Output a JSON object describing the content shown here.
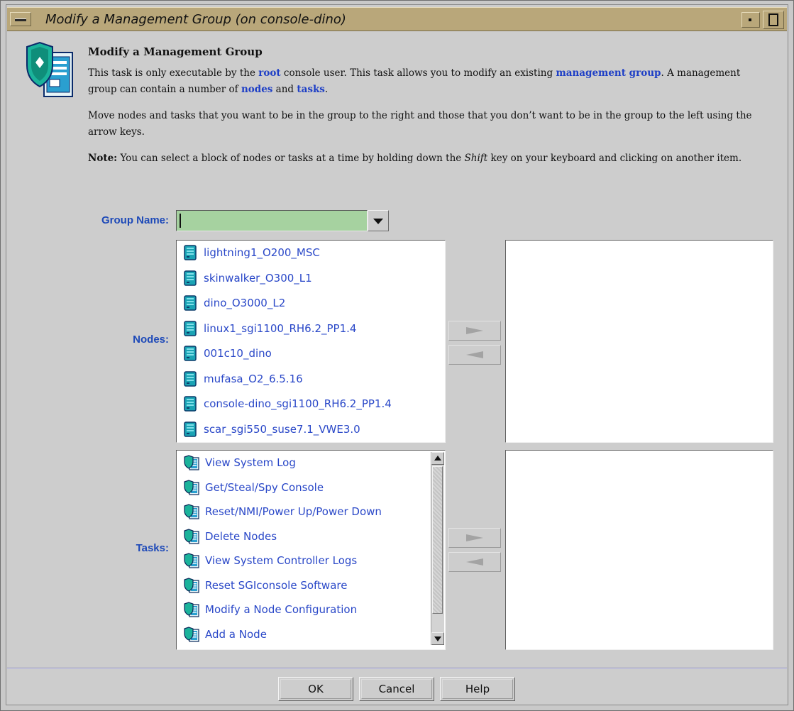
{
  "window": {
    "title": "Modify a Management Group (on console-dino)"
  },
  "header": {
    "heading": "Modify a Management Group",
    "p1": {
      "t1": "This task is only executable by the ",
      "l1": "root",
      "t2": " console user. This task allows you to modify an existing ",
      "l2": "management group",
      "t3": ". A management group can contain a number of ",
      "l3": "nodes",
      "t4": " and ",
      "l4": "tasks",
      "t5": "."
    },
    "p2": "Move nodes and tasks that you want to be in the group to the right and those that you don’t want to be in the group to the left using the arrow keys.",
    "p3": {
      "note_label": "Note:",
      "t1": " You can select a block of nodes or tasks at a time by holding down the ",
      "em": "Shift",
      "t2": " key on your keyboard and clicking on another item."
    }
  },
  "form": {
    "group_name_label": "Group Name:",
    "group_name_value": "",
    "nodes_label": "Nodes:",
    "tasks_label": "Tasks:"
  },
  "nodes": [
    "lightning1_O200_MSC",
    "skinwalker_O300_L1",
    "dino_O3000_L2",
    "linux1_sgi1100_RH6.2_PP1.4",
    "001c10_dino",
    "mufasa_O2_6.5.16",
    "console-dino_sgi1100_RH6.2_PP1.4",
    "scar_sgi550_suse7.1_VWE3.0"
  ],
  "tasks": [
    "View System Log",
    "Get/Steal/Spy Console",
    "Reset/NMI/Power Up/Power Down",
    "Delete Nodes",
    "View System Controller Logs",
    "Reset SGIconsole Software",
    "Modify a Node Configuration",
    "Add a Node"
  ],
  "buttons": {
    "ok": "OK",
    "cancel": "Cancel",
    "help": "Help"
  },
  "colors": {
    "title_bar": "#b9a77a",
    "link": "#1e3fc6",
    "label": "#1d49b8",
    "combo_field": "#a6d2a0"
  },
  "icons": {
    "window_menu": "window-menu-icon",
    "minimize": "minimize-icon",
    "maximize": "maximize-icon",
    "task": "task-shield-document-icon",
    "node": "node-server-icon",
    "task_item": "task-item-icon"
  }
}
